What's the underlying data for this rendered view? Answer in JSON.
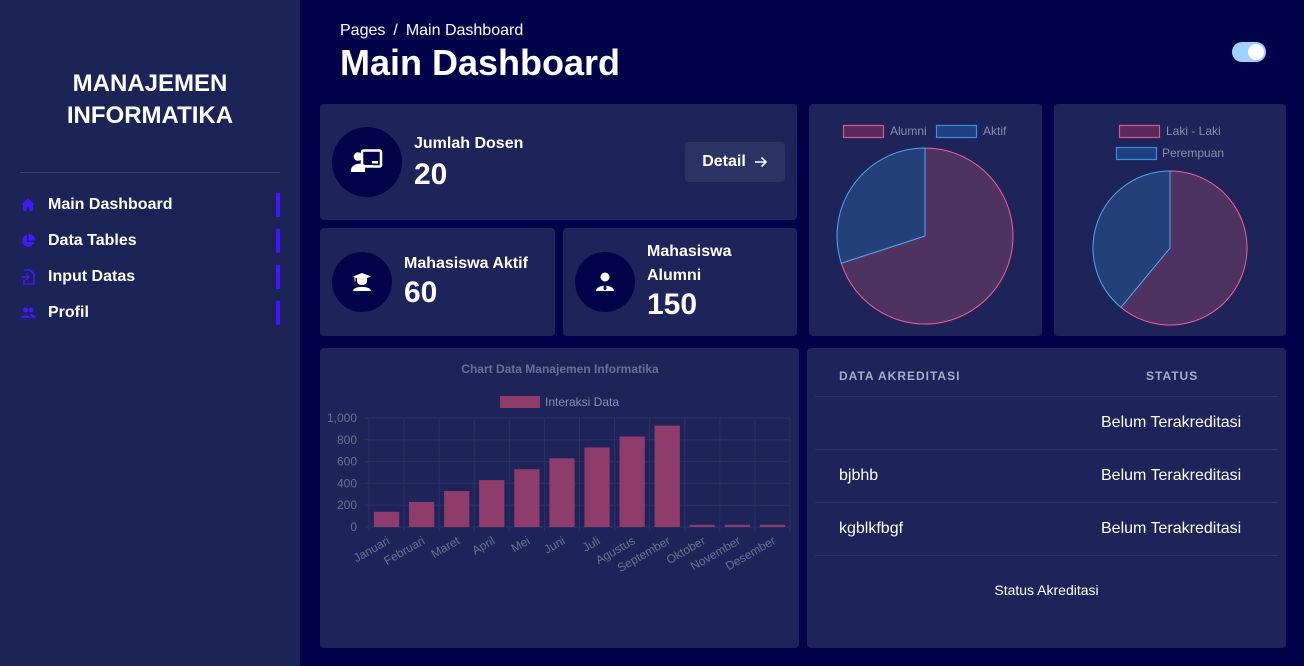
{
  "sidebar": {
    "brand_line1": "MANAJEMEN",
    "brand_line2": "INFORMATIKA",
    "items": [
      {
        "label": "Main Dashboard",
        "icon": "home-icon"
      },
      {
        "label": "Data Tables",
        "icon": "pie-chart-icon"
      },
      {
        "label": "Input Datas",
        "icon": "input-icon"
      },
      {
        "label": "Profil",
        "icon": "users-icon"
      }
    ],
    "accent": "#4318ff"
  },
  "header": {
    "breadcrumb_root": "Pages",
    "breadcrumb_sep": "/",
    "breadcrumb_current": "Main Dashboard",
    "title": "Main Dashboard"
  },
  "stats": {
    "dosen": {
      "label": "Jumlah Dosen",
      "value": "20",
      "button": "Detail"
    },
    "aktif": {
      "label": "Mahasiswa Aktif",
      "value": "60"
    },
    "alumni": {
      "label_line1": "Mahasiswa",
      "label_line2": "Alumni",
      "value": "150"
    }
  },
  "bar_chart_card": {
    "title": "Chart Data Manajemen Informatika"
  },
  "chart_data": [
    {
      "type": "pie",
      "labels": [
        "Alumni",
        "Aktif"
      ],
      "values": [
        70,
        30
      ],
      "colors": [
        "#f06292",
        "#4fa3f7"
      ]
    },
    {
      "type": "pie",
      "labels": [
        "Laki - Laki",
        "Perempuan"
      ],
      "values": [
        61,
        39
      ],
      "colors": [
        "#f06292",
        "#4fa3f7"
      ]
    },
    {
      "type": "bar",
      "title": "Chart Data Manajemen Informatika",
      "categories": [
        "Januari",
        "Februari",
        "Maret",
        "April",
        "Mei",
        "Juni",
        "Juli",
        "Agustus",
        "September",
        "Oktober",
        "November",
        "Desember"
      ],
      "series": [
        {
          "name": "Interaksi Data",
          "values": [
            140,
            230,
            330,
            430,
            530,
            630,
            730,
            830,
            930,
            20,
            20,
            20
          ]
        }
      ],
      "ylim": [
        0,
        1000
      ],
      "yticks": [
        "0",
        "200",
        "400",
        "600",
        "800",
        "1,000"
      ],
      "color": "#8e3c6b"
    }
  ],
  "accreditation": {
    "headers": [
      "DATA AKREDITASI",
      "STATUS"
    ],
    "rows": [
      {
        "name": "",
        "status": "Belum Terakreditasi"
      },
      {
        "name": "bjbhb",
        "status": "Belum Terakreditasi"
      },
      {
        "name": "kgblkfbgf",
        "status": "Belum Terakreditasi"
      }
    ],
    "caption": "Status Akreditasi"
  }
}
